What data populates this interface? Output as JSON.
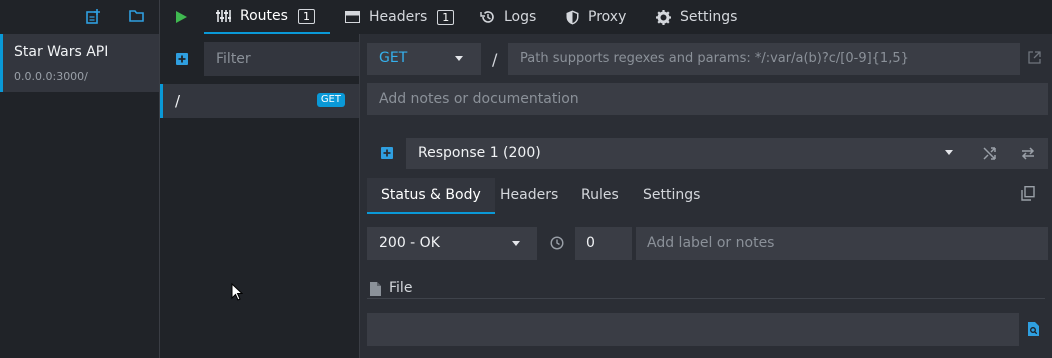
{
  "environment_toolbar": {
    "icons": [
      "new-environment-icon",
      "open-folder-icon"
    ]
  },
  "environment": {
    "name": "Star Wars API",
    "host": "0.0.0.0:3000/"
  },
  "topbar": {
    "run_icon": "play-icon",
    "tabs": [
      {
        "label": "Routes",
        "icon": "routes-icon",
        "count": "1",
        "active": true
      },
      {
        "label": "Headers",
        "icon": "headers-icon",
        "count": "1"
      },
      {
        "label": "Logs",
        "icon": "history-icon"
      },
      {
        "label": "Proxy",
        "icon": "shield-icon"
      },
      {
        "label": "Settings",
        "icon": "gear-icon"
      }
    ]
  },
  "routes": {
    "filter_placeholder": "Filter",
    "items": [
      {
        "path": "/",
        "method": "GET"
      }
    ]
  },
  "route_editor": {
    "method": "GET",
    "path_separator": "/",
    "path_placeholder": "Path supports regexes and params: */:var/a(b)?c/[0-9]{1,5}",
    "notes_placeholder": "Add notes or documentation"
  },
  "response": {
    "selected": "Response 1 (200)",
    "subtabs": [
      "Status & Body",
      "Headers",
      "Rules",
      "Settings"
    ],
    "status": "200 - OK",
    "latency": "0",
    "label_placeholder": "Add label or notes",
    "body_type_label": "File"
  },
  "colors": {
    "accent": "#0a99d7",
    "panel": "#202328",
    "background": "#2b2e35",
    "field": "#3a3d45",
    "run_green": "#3fb950"
  }
}
